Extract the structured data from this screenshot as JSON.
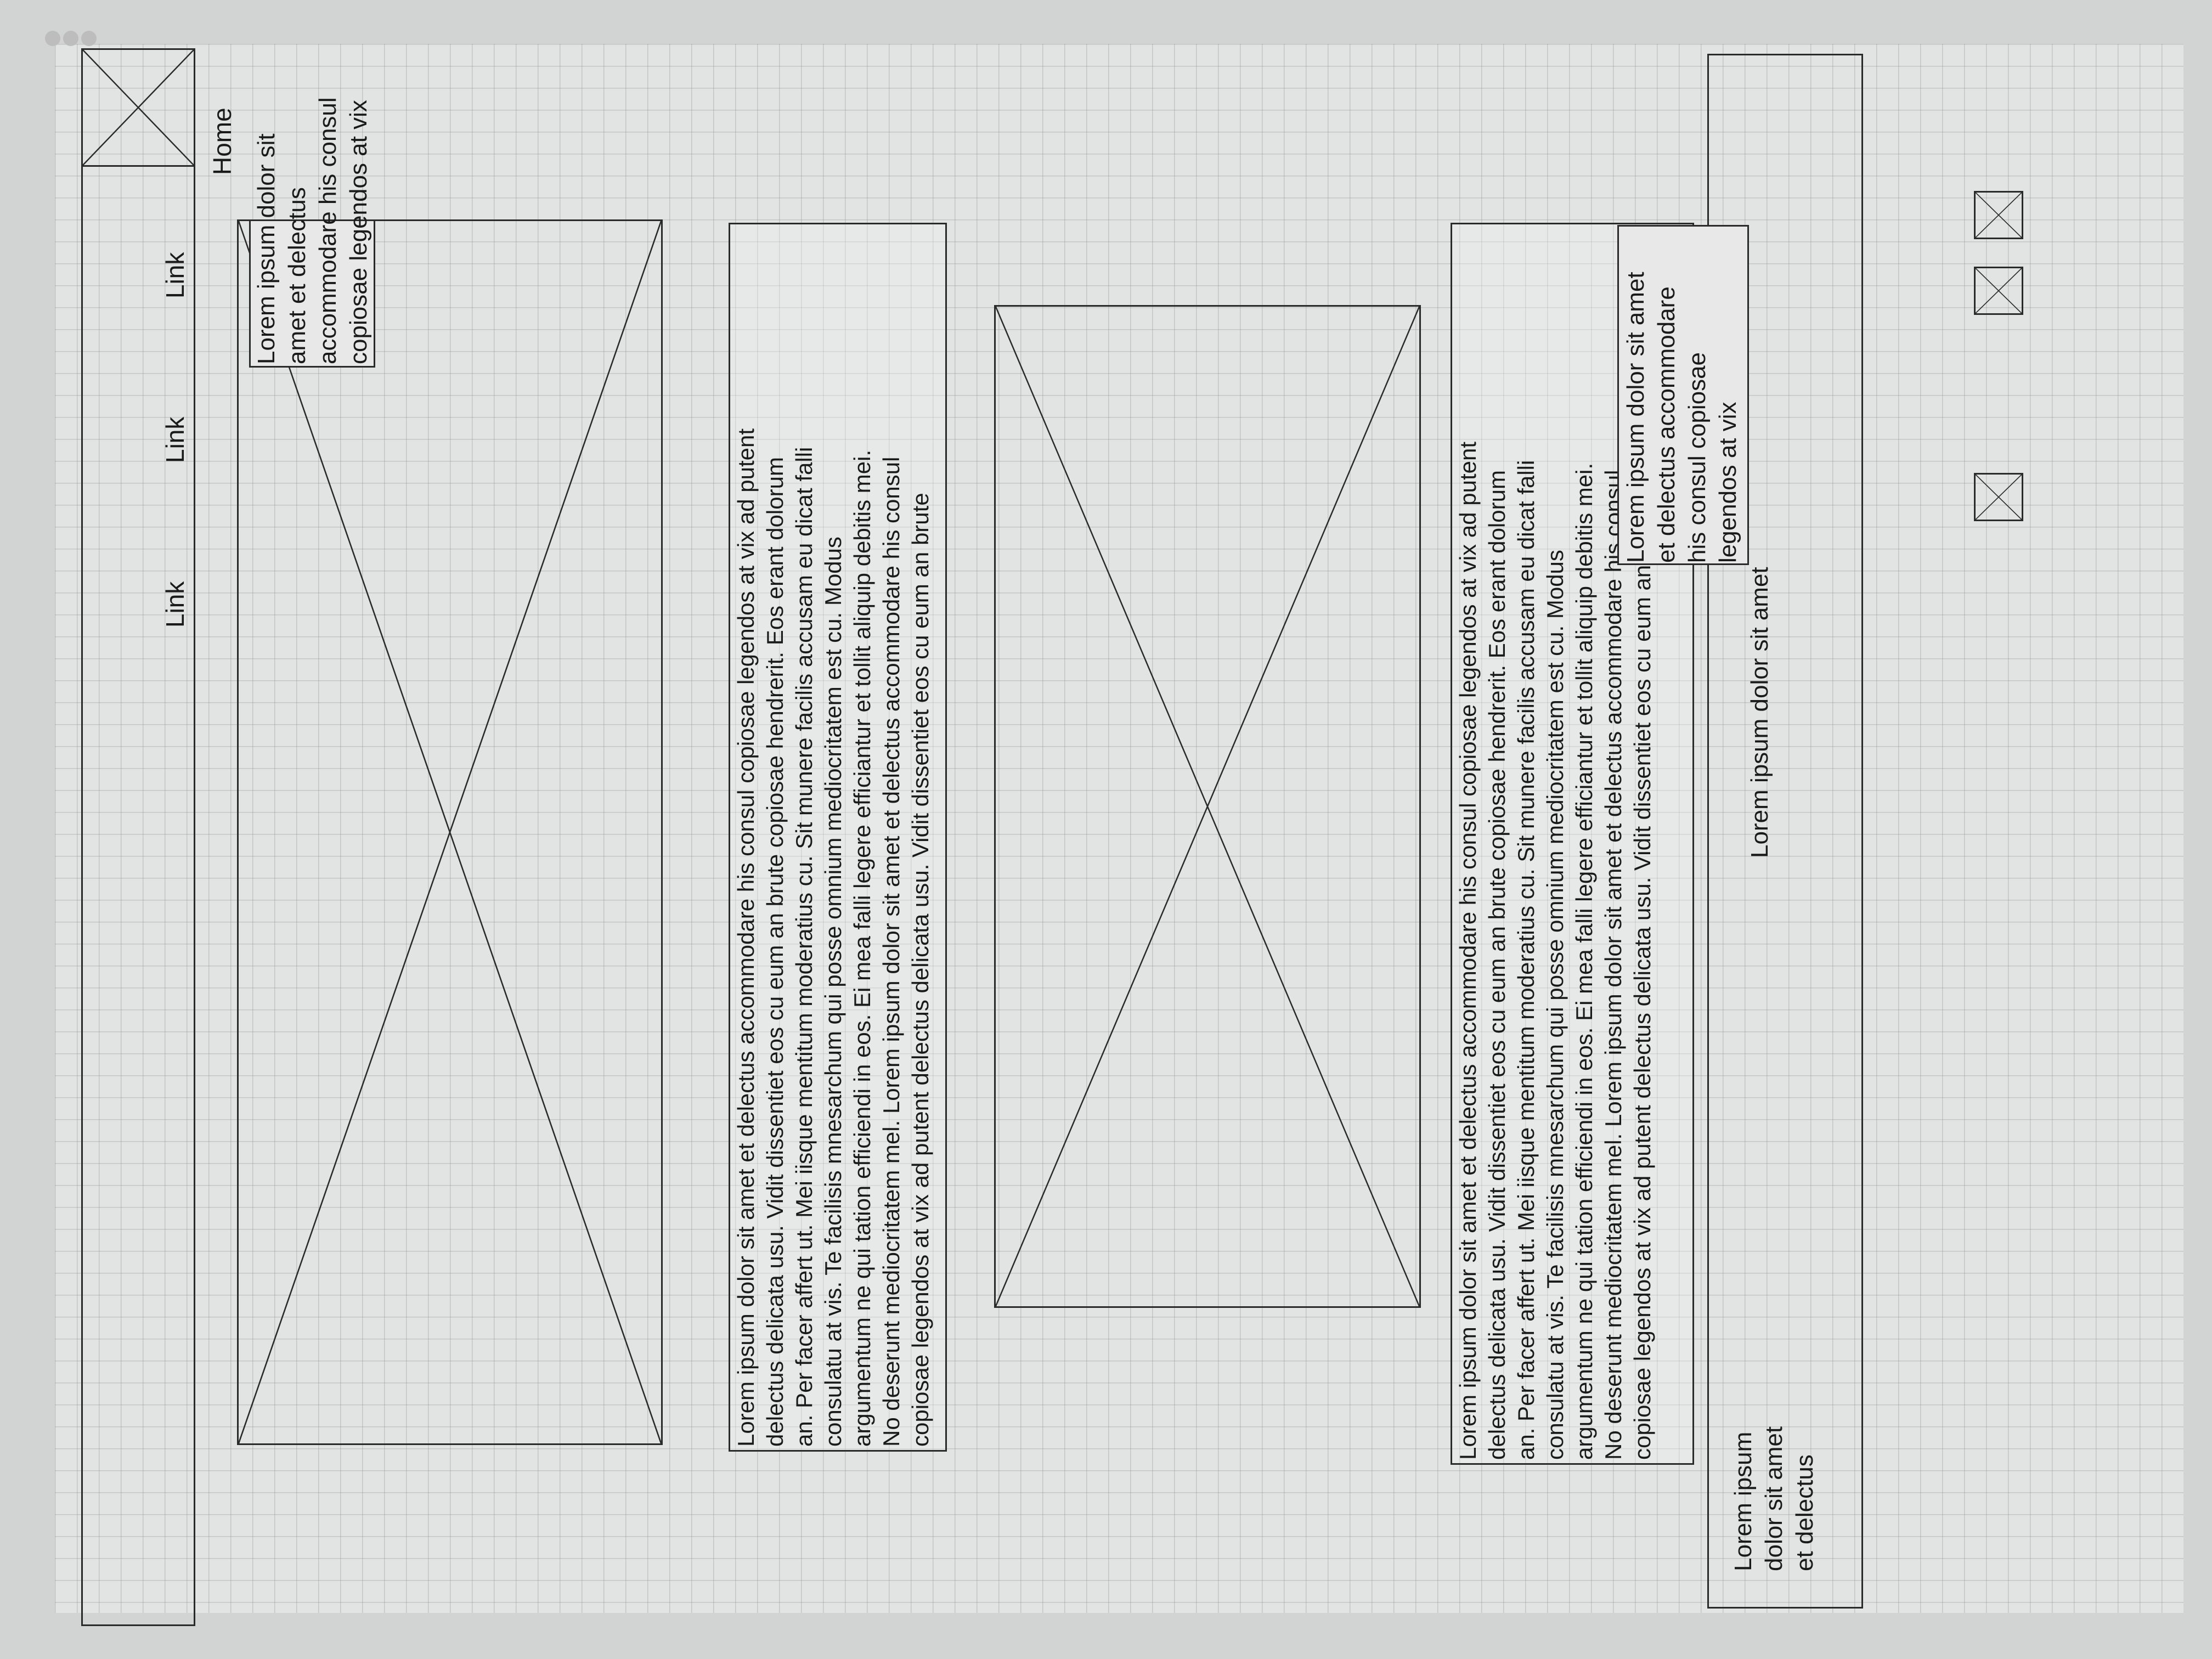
{
  "header": {
    "logo_icon": "image-placeholder-icon",
    "nav_links": [
      "Link",
      "Link",
      "Link"
    ],
    "breadcrumb": "Home"
  },
  "hero": {
    "image_icon": "image-placeholder-icon",
    "caption_left": "Lorem ipsum dolor sit\namet et delectus\naccommodare his consul\ncopiosae legendos at vix",
    "caption_right": "Lorem ipsum dolor sit amet\net delectus accommodare\nhis consul copiosae\nlegendos at vix"
  },
  "content": {
    "paragraph_1": "Lorem ipsum dolor sit amet et delectus accommodare his consul copiosae legendos at vix ad putent\ndelectus delicata usu. Vidit dissentiet eos cu eum an brute copiosae hendrerit. Eos erant dolorum\nan. Per facer affert ut. Mei iisque mentitum moderatius cu. Sit munere facilis accusam eu dicat falli\nconsulatu at vis. Te facilisis mnesarchum qui posse omnium mediocritatem est cu. Modus\nargumentum ne qui tation efficiendi in eos. Ei mea falli legere efficiantur et tollit aliquip debitis mei.\nNo deserunt mediocritatem mel. Lorem ipsum dolor sit amet et delectus accommodare his consul\ncopiosae legendos at vix ad putent delectus delicata usu. Vidit dissentiet eos cu eum an brute",
    "image_icon": "image-placeholder-icon",
    "paragraph_2": "Lorem ipsum dolor sit amet et delectus accommodare his consul copiosae legendos at vix ad putent\ndelectus delicata usu. Vidit dissentiet eos cu eum an brute copiosae hendrerit. Eos erant dolorum\nan. Per facer affert ut. Mei iisque mentitum moderatius cu. Sit munere facilis accusam eu dicat falli\nconsulatu at vis. Te facilisis mnesarchum qui posse omnium mediocritatem est cu. Modus\nargumentum ne qui tation efficiendi in eos. Ei mea falli legere efficiantur et tollit aliquip debitis mei.\nNo deserunt mediocritatem mel. Lorem ipsum dolor sit amet et delectus accommodare his consul\ncopiosae legendos at vix ad putent delectus delicata usu. Vidit dissentiet eos cu eum an brute"
  },
  "footer": {
    "text_left": "Lorem ipsum\ndolor sit amet\net delectus",
    "text_center": "Lorem ipsum dolor sit amet",
    "social_icons": [
      "image-placeholder-icon",
      "image-placeholder-icon",
      "image-placeholder-icon"
    ]
  }
}
